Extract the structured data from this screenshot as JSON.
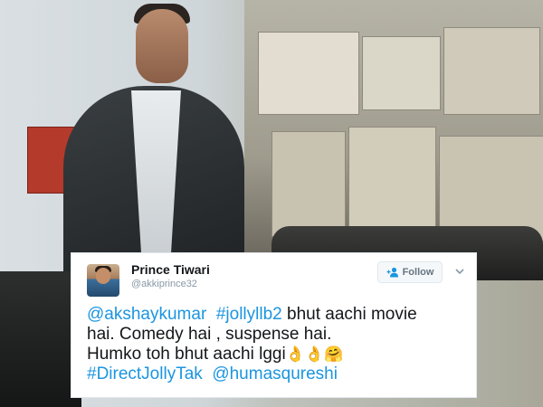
{
  "tweet": {
    "author_name": "Prince Tiwari",
    "author_handle": "@akkiprince32",
    "follow_label": "Follow",
    "lines": [
      {
        "parts": [
          {
            "text": "@akshaykumar",
            "type": "mention"
          },
          {
            "text": "  ",
            "type": "text"
          },
          {
            "text": "#jollyllb2",
            "type": "hashtag"
          },
          {
            "text": " bhut aachi movie",
            "type": "text"
          }
        ]
      },
      {
        "parts": [
          {
            "text": "hai. Comedy hai , suspense hai.",
            "type": "text"
          }
        ]
      },
      {
        "parts": [
          {
            "text": "Humko toh bhut aachi lggi",
            "type": "text"
          },
          {
            "text": "👌👌🤗",
            "type": "emoji"
          }
        ]
      },
      {
        "parts": [
          {
            "text": "#DirectJollyTak",
            "type": "hashtag"
          },
          {
            "text": "  ",
            "type": "text"
          },
          {
            "text": "@humasqureshi",
            "type": "mention"
          }
        ]
      }
    ]
  },
  "colors": {
    "link": "#1b95e0",
    "text": "#14171a",
    "muted": "#8899a6"
  },
  "icons": {
    "follow": "add-person-icon",
    "menu": "chevron-down-icon"
  }
}
